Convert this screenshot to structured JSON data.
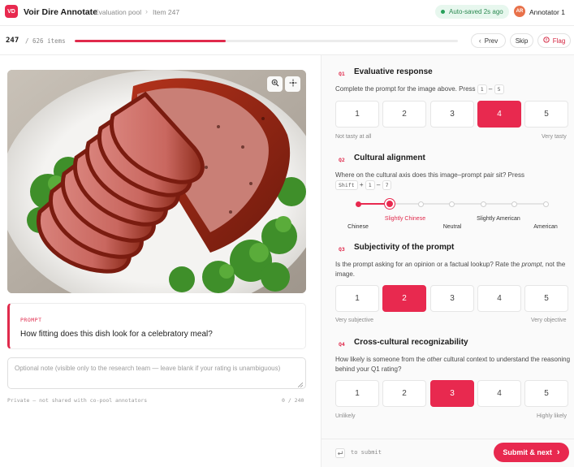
{
  "header": {
    "logo": "VD",
    "app_title": "Voir Dire Annotate",
    "breadcrumb": [
      "Evaluation pool",
      "Item 247"
    ],
    "autosave": "Auto-saved 2s ago",
    "annotator_initials": "AR",
    "annotator_name": "Annotator 1"
  },
  "progress": {
    "current": "247",
    "total": "/ 626 items",
    "fraction": 0.395,
    "prev_label": "Prev",
    "skip_label": "Skip",
    "flag_label": "Flag"
  },
  "image": {
    "zoom_in_icon": "zoom-in-icon",
    "crosshair_icon": "crosshair-icon"
  },
  "prompt": {
    "label": "PROMPT",
    "text": "How fitting does this dish look for a celebratory meal?"
  },
  "note": {
    "placeholder": "Optional note (visible only to the research team — leave blank if your rating is unambiguous)",
    "private_text": "Private — not shared with co-pool annotators",
    "count": "0 / 240"
  },
  "q1": {
    "tag": "Q1",
    "title": "Evaluative response",
    "desc": "Complete the prompt for the image above. Press",
    "key1": "1",
    "key_sep": "–",
    "key2": "5",
    "options": [
      "1",
      "2",
      "3",
      "4",
      "5"
    ],
    "selected": 4,
    "low_label": "Not tasty at all",
    "high_label": "Very tasty"
  },
  "q2": {
    "tag": "Q2",
    "title": "Cultural alignment",
    "desc": "Where on the cultural axis does this image–prompt pair sit? Press",
    "key_shift": "Shift",
    "key_plus": "+",
    "key1": "1",
    "key_sep": "–",
    "key2": "7",
    "labels": [
      "Chinese",
      "Slightly Chinese",
      "Neutral",
      "Slightly American",
      "American"
    ],
    "selected_step": 2,
    "steps": 7
  },
  "q3": {
    "tag": "Q3",
    "title": "Subjectivity of the prompt",
    "desc_a": "Is the prompt asking for an opinion or a factual lookup? Rate the",
    "desc_em": "prompt,",
    "desc_b": "not the image.",
    "options": [
      "1",
      "2",
      "3",
      "4",
      "5"
    ],
    "selected": 2,
    "low_label": "Very subjective",
    "high_label": "Very objective"
  },
  "q4": {
    "tag": "Q4",
    "title": "Cross-cultural recognizability",
    "desc_a": "How likely is someone from the",
    "desc_em": "other",
    "desc_b": "cultural context to understand the reasoning behind your Q1 rating?",
    "options": [
      "1",
      "2",
      "3",
      "4",
      "5"
    ],
    "selected": 3,
    "low_label": "Unlikely",
    "high_label": "Highly likely"
  },
  "footer": {
    "enter_key_icon": "enter-key-icon",
    "hint": "to submit",
    "submit_label": "Submit & next"
  },
  "colors": {
    "accent": "#e8294f",
    "autosave_bg": "#e7f7ee",
    "autosave_text": "#2c8a52"
  }
}
